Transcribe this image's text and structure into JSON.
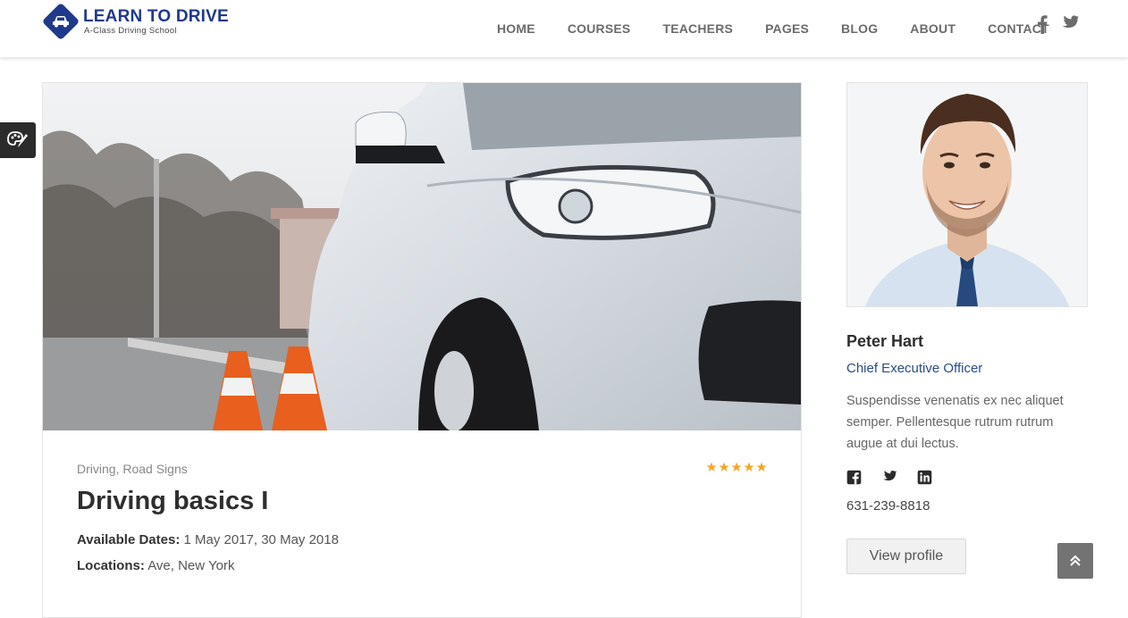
{
  "brand": {
    "title": "LEARN TO DRIVE",
    "subtitle": "A-Class Driving School",
    "color": "#1f3a8a"
  },
  "nav": {
    "items": [
      "HOME",
      "COURSES",
      "TEACHERS",
      "PAGES",
      "BLOG",
      "ABOUT",
      "CONTACT"
    ]
  },
  "social_top": [
    "facebook-icon",
    "twitter-icon"
  ],
  "side_tab_icon": "palette-icon",
  "course": {
    "category": "Driving, Road Signs",
    "rating": 5,
    "star_color": "#f5a623",
    "title": "Driving basics I",
    "dates_label": "Available Dates:",
    "dates_value": "1 May 2017, 30 May 2018",
    "locations_label": "Locations:",
    "locations_value": "Ave, New York"
  },
  "teacher": {
    "name": "Peter Hart",
    "role": "Chief Executive Officer",
    "bio": "Suspendisse venenatis ex nec aliquet semper. Pellentesque rutrum rutrum augue at dui lectus.",
    "social": [
      "facebook-square-icon",
      "twitter-icon",
      "linkedin-icon"
    ],
    "phone": "631-239-8818",
    "button_label": "View profile"
  },
  "scroll_top_icon": "double-chevron-up-icon"
}
